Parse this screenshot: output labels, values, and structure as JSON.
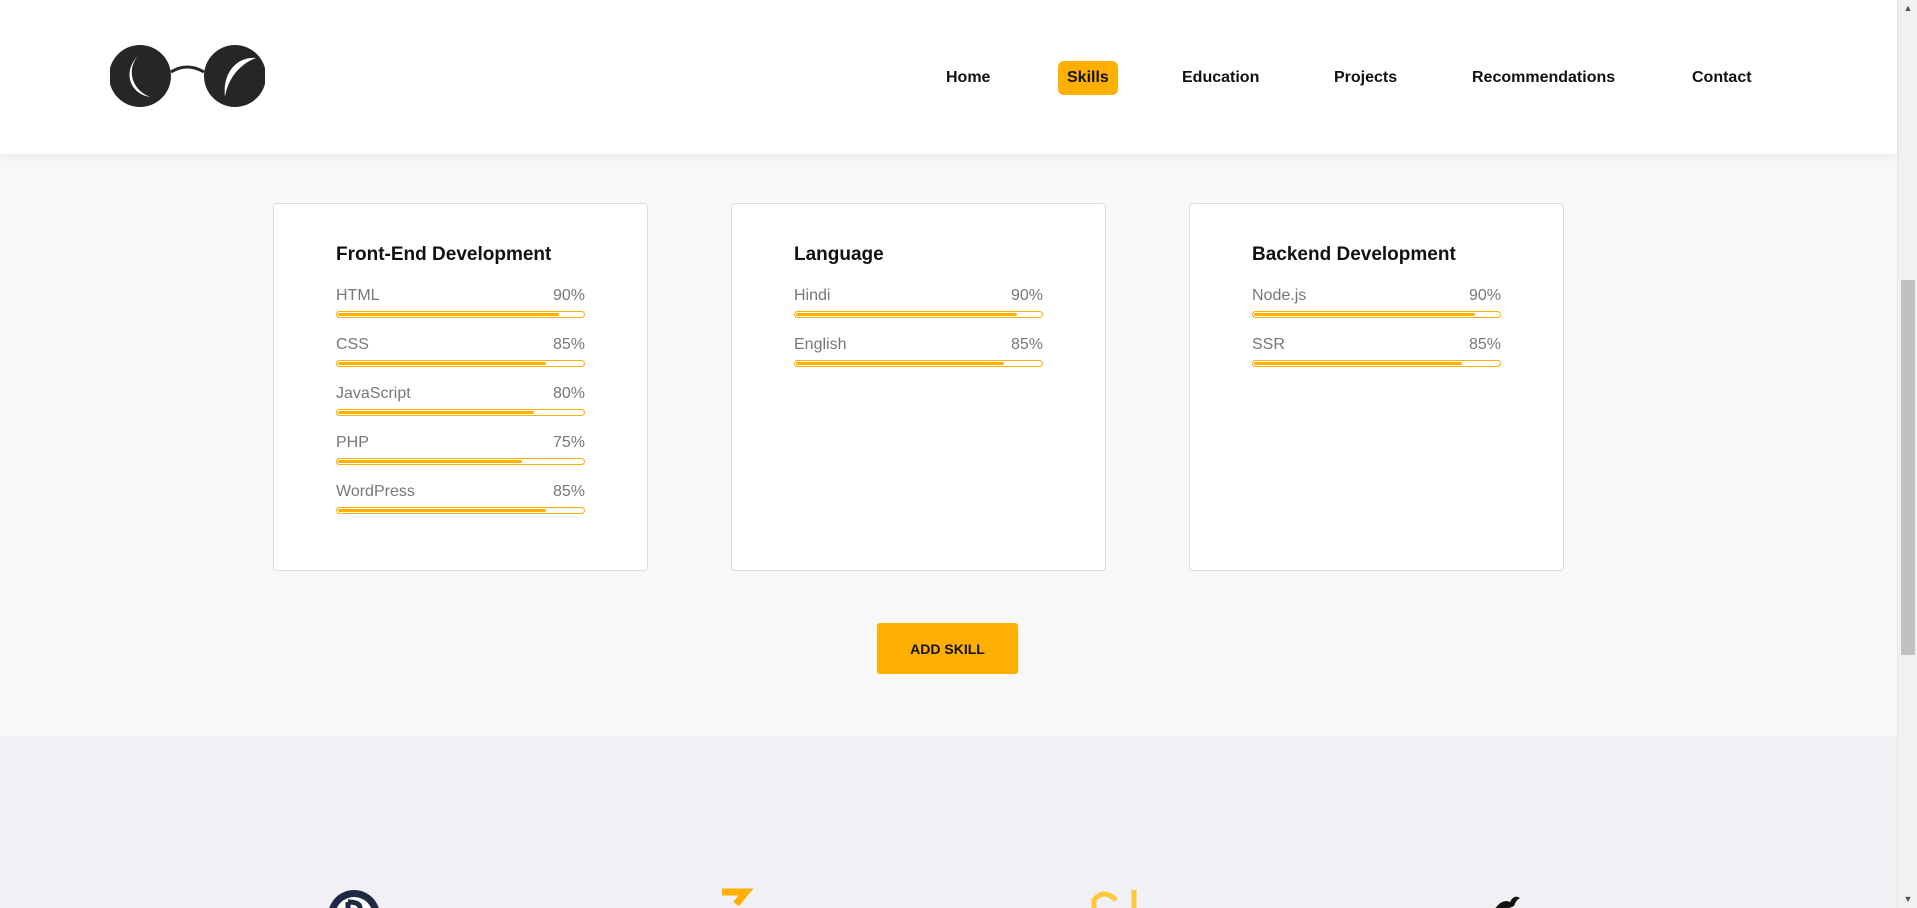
{
  "nav": {
    "items": [
      {
        "label": "Home",
        "active": false
      },
      {
        "label": "Skills",
        "active": true
      },
      {
        "label": "Education",
        "active": false
      },
      {
        "label": "Projects",
        "active": false
      },
      {
        "label": "Recommendations",
        "active": false
      },
      {
        "label": "Contact",
        "active": false
      }
    ]
  },
  "skill_cards": [
    {
      "title": "Front-End Development",
      "skills": [
        {
          "name": "HTML",
          "percent_label": "90%",
          "level": 90
        },
        {
          "name": "CSS",
          "percent_label": "85%",
          "level": 85
        },
        {
          "name": "JavaScript",
          "percent_label": "80%",
          "level": 80
        },
        {
          "name": "PHP",
          "percent_label": "75%",
          "level": 75
        },
        {
          "name": "WordPress",
          "percent_label": "85%",
          "level": 85
        }
      ]
    },
    {
      "title": "Language",
      "skills": [
        {
          "name": "Hindi",
          "percent_label": "90%",
          "level": 90
        },
        {
          "name": "English",
          "percent_label": "85%",
          "level": 85
        }
      ]
    },
    {
      "title": "Backend Development",
      "skills": [
        {
          "name": "Node.js",
          "percent_label": "90%",
          "level": 90
        },
        {
          "name": "SSR",
          "percent_label": "85%",
          "level": 85
        }
      ]
    }
  ],
  "add_skill_label": "ADD SKILL",
  "colors": {
    "accent": "#ffaf00",
    "text": "#111111",
    "muted": "#777777",
    "section_bg": "#f8f8f8",
    "lower_bg": "#f0f0f5"
  },
  "icons": {
    "logo": "glasses-logo-icon",
    "scroll_up": "scroll-up-arrow-icon",
    "scroll_down": "scroll-down-arrow-icon"
  }
}
